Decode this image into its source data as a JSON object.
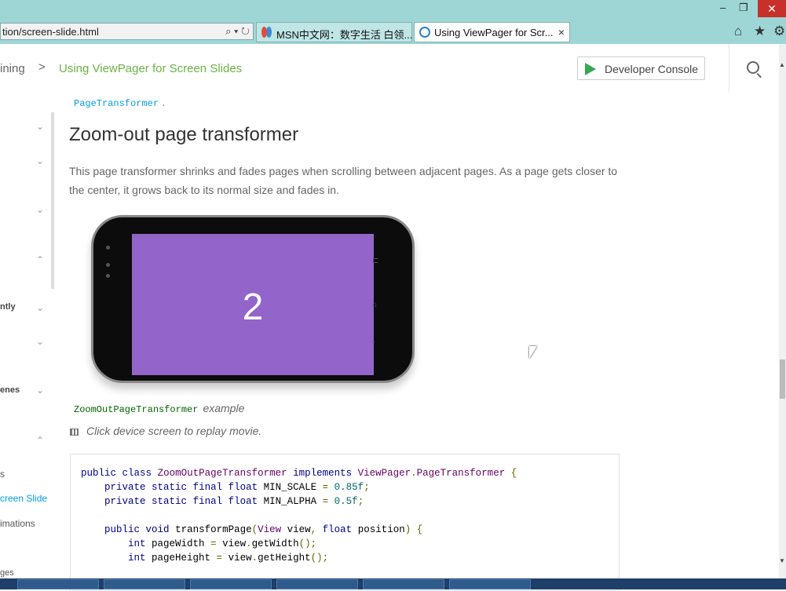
{
  "browser": {
    "address": "tion/screen-slide.html",
    "address_icons": "⌕ ▾ ↻",
    "tabs": [
      {
        "label": "MSN中文网：数字生活 白领..."
      },
      {
        "label": "Using ViewPager for Scr...",
        "close": "×"
      }
    ],
    "window": {
      "minimize": "‒",
      "restore": "❐",
      "close": "✕"
    },
    "tools": {
      "home": "⌂",
      "favorites": "★",
      "settings": "⚙"
    }
  },
  "header": {
    "crumb_parent": "ining",
    "crumb_sep": ">",
    "crumb_current": "Using ViewPager for Screen Slides",
    "dev_console": "Developer Console"
  },
  "sidebar": {
    "labels": [
      "ntly",
      "enes"
    ],
    "links": [
      "s",
      "creen Slide",
      "imations",
      "ges"
    ],
    "chevrons": [
      "⌄",
      "⌄",
      "⌄",
      "⌃",
      "⌄",
      "⌄",
      "⌄",
      "⌃"
    ]
  },
  "content": {
    "inline_code": "PageTransformer",
    "inline_period": ".",
    "heading": "Zoom-out page transformer",
    "paragraph": "This page transformer shrinks and fades pages when scrolling between adjacent pages. As a page gets closer to the center, it grows back to its normal size and fades in.",
    "phone_number": "2",
    "caption_code": "ZoomOutPageTransformer",
    "caption_text": "example",
    "replay": "Click device screen to replay movie."
  },
  "code": {
    "lines": [
      [
        [
          "kw",
          "public"
        ],
        [
          "pl",
          " "
        ],
        [
          "kw",
          "class"
        ],
        [
          "pl",
          " "
        ],
        [
          "ty",
          "ZoomOutPageTransformer"
        ],
        [
          "pl",
          " "
        ],
        [
          "kw",
          "implements"
        ],
        [
          "pl",
          " "
        ],
        [
          "ty",
          "ViewPager"
        ],
        [
          "pu",
          "."
        ],
        [
          "ty",
          "PageTransformer"
        ],
        [
          "pl",
          " "
        ],
        [
          "pu",
          "{"
        ]
      ],
      [
        [
          "pl",
          "    "
        ],
        [
          "kw",
          "private"
        ],
        [
          "pl",
          " "
        ],
        [
          "kw",
          "static"
        ],
        [
          "pl",
          " "
        ],
        [
          "kw",
          "final"
        ],
        [
          "pl",
          " "
        ],
        [
          "kw",
          "float"
        ],
        [
          "pl",
          " MIN_SCALE "
        ],
        [
          "pu",
          "="
        ],
        [
          "pl",
          " "
        ],
        [
          "lit",
          "0.85f"
        ],
        [
          "pu",
          ";"
        ]
      ],
      [
        [
          "pl",
          "    "
        ],
        [
          "kw",
          "private"
        ],
        [
          "pl",
          " "
        ],
        [
          "kw",
          "static"
        ],
        [
          "pl",
          " "
        ],
        [
          "kw",
          "final"
        ],
        [
          "pl",
          " "
        ],
        [
          "kw",
          "float"
        ],
        [
          "pl",
          " MIN_ALPHA "
        ],
        [
          "pu",
          "="
        ],
        [
          "pl",
          " "
        ],
        [
          "lit",
          "0.5f"
        ],
        [
          "pu",
          ";"
        ]
      ],
      [
        [
          "pl",
          ""
        ]
      ],
      [
        [
          "pl",
          "    "
        ],
        [
          "kw",
          "public"
        ],
        [
          "pl",
          " "
        ],
        [
          "kw",
          "void"
        ],
        [
          "pl",
          " transformPage"
        ],
        [
          "pu",
          "("
        ],
        [
          "ty",
          "View"
        ],
        [
          "pl",
          " view"
        ],
        [
          "pu",
          ","
        ],
        [
          "pl",
          " "
        ],
        [
          "kw",
          "float"
        ],
        [
          "pl",
          " position"
        ],
        [
          "pu",
          ")"
        ],
        [
          "pl",
          " "
        ],
        [
          "pu",
          "{"
        ]
      ],
      [
        [
          "pl",
          "        "
        ],
        [
          "kw",
          "int"
        ],
        [
          "pl",
          " pageWidth "
        ],
        [
          "pu",
          "="
        ],
        [
          "pl",
          " view"
        ],
        [
          "pu",
          "."
        ],
        [
          "pl",
          "getWidth"
        ],
        [
          "pu",
          "();"
        ]
      ],
      [
        [
          "pl",
          "        "
        ],
        [
          "kw",
          "int"
        ],
        [
          "pl",
          " pageHeight "
        ],
        [
          "pu",
          "="
        ],
        [
          "pl",
          " view"
        ],
        [
          "pu",
          "."
        ],
        [
          "pl",
          "getHeight"
        ],
        [
          "pu",
          "();"
        ]
      ]
    ]
  },
  "colors": {
    "accent_green": "#6ab344",
    "link_blue": "#039be5",
    "phone_screen": "#9364c9"
  }
}
